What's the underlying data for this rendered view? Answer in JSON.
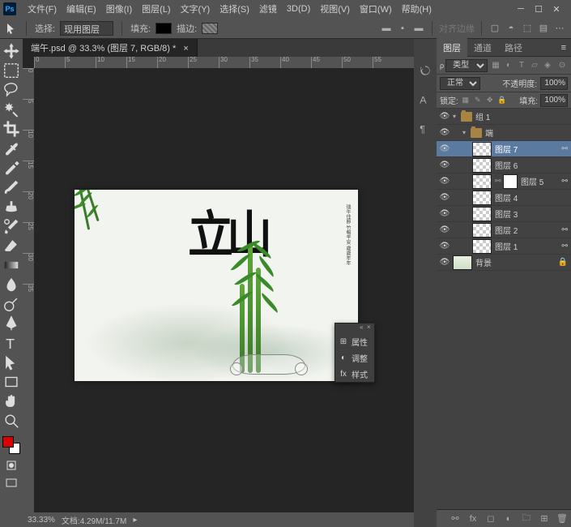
{
  "menubar": {
    "items": [
      "文件(F)",
      "编辑(E)",
      "图像(I)",
      "图层(L)",
      "文字(Y)",
      "选择(S)",
      "滤镜",
      "3D(D)",
      "视图(V)",
      "窗口(W)",
      "帮助(H)"
    ]
  },
  "optionsbar": {
    "selection_label": "选择:",
    "selection_value": "现用图层",
    "fill_label": "填充:",
    "stroke_label": "描边:",
    "align_label": "对齐边缘"
  },
  "tab": {
    "title": "端午.psd @ 33.3% (图层 7, RGB/8) *"
  },
  "ruler_h": [
    "0",
    "5",
    "10",
    "15",
    "20",
    "25",
    "30",
    "35",
    "40",
    "45",
    "50",
    "55"
  ],
  "ruler_v": [
    "0",
    "5",
    "10",
    "15",
    "20",
    "25",
    "30",
    "35"
  ],
  "canvas": {
    "calligraphy": "立山",
    "vtext": "瑞午佳節 竹報平安 歲歲年年"
  },
  "float_panel": {
    "items": [
      {
        "icon": "⊞",
        "label": "属性"
      },
      {
        "icon": "◐",
        "label": "调整"
      },
      {
        "icon": "fx",
        "label": "样式"
      }
    ]
  },
  "statusbar": {
    "zoom": "33.33%",
    "doc": "文档:4.29M/11.7M"
  },
  "panels": {
    "tabs": [
      "图层",
      "通道",
      "路径"
    ],
    "filter_label": "类型",
    "blend_mode": "正常",
    "opacity_label": "不透明度:",
    "opacity_value": "100%",
    "lock_label": "锁定:",
    "fill_label": "填充:",
    "fill_value": "100%"
  },
  "layers": [
    {
      "type": "group",
      "indent": 0,
      "name": "组 1",
      "vis": true,
      "open": true
    },
    {
      "type": "group",
      "indent": 1,
      "name": "端",
      "vis": true,
      "open": true
    },
    {
      "type": "layer",
      "indent": 2,
      "name": "图层 7",
      "vis": true,
      "selected": true,
      "link": true
    },
    {
      "type": "layer",
      "indent": 2,
      "name": "图层 6",
      "vis": true
    },
    {
      "type": "layer",
      "indent": 2,
      "name": "图层 5",
      "vis": true,
      "mask": true,
      "link": true
    },
    {
      "type": "layer",
      "indent": 2,
      "name": "图层 4",
      "vis": true
    },
    {
      "type": "layer",
      "indent": 2,
      "name": "图层 3",
      "vis": true
    },
    {
      "type": "layer",
      "indent": 2,
      "name": "图层 2",
      "vis": true,
      "link": true
    },
    {
      "type": "layer",
      "indent": 2,
      "name": "图层 1",
      "vis": true,
      "link": true
    },
    {
      "type": "bg",
      "indent": 0,
      "name": "背景",
      "vis": true,
      "locked": true
    }
  ]
}
